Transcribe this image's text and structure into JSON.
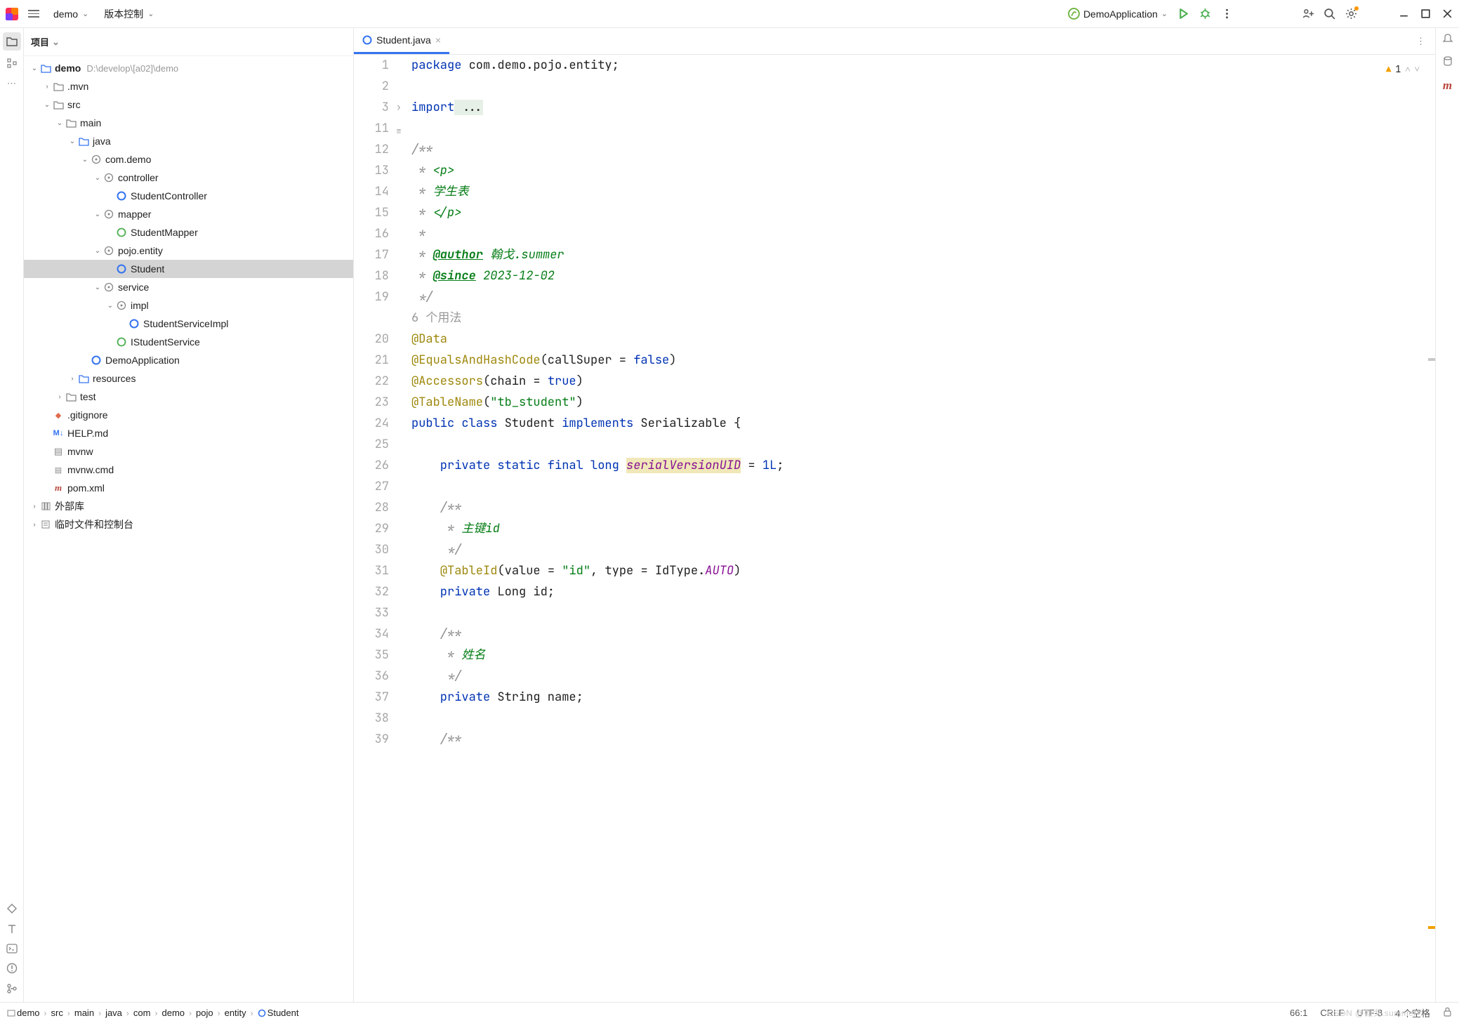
{
  "topbar": {
    "project": "demo",
    "vcs": "版本控制",
    "runConfig": "DemoApplication"
  },
  "sidebar": {
    "title": "项目"
  },
  "tree": [
    {
      "d": 0,
      "exp": "open",
      "ic": "folder-blue",
      "label": "demo",
      "path": "D:\\develop\\[a02]\\demo",
      "bold": true
    },
    {
      "d": 1,
      "exp": "closed",
      "ic": "folder",
      "label": ".mvn"
    },
    {
      "d": 1,
      "exp": "open",
      "ic": "folder",
      "label": "src"
    },
    {
      "d": 2,
      "exp": "open",
      "ic": "folder",
      "label": "main"
    },
    {
      "d": 3,
      "exp": "open",
      "ic": "folder-blue",
      "label": "java"
    },
    {
      "d": 4,
      "exp": "open",
      "ic": "pkg",
      "label": "com.demo"
    },
    {
      "d": 5,
      "exp": "open",
      "ic": "pkg",
      "label": "controller"
    },
    {
      "d": 6,
      "exp": "none",
      "ic": "class",
      "label": "StudentController"
    },
    {
      "d": 5,
      "exp": "open",
      "ic": "pkg",
      "label": "mapper"
    },
    {
      "d": 6,
      "exp": "none",
      "ic": "iface",
      "label": "StudentMapper"
    },
    {
      "d": 5,
      "exp": "open",
      "ic": "pkg",
      "label": "pojo.entity"
    },
    {
      "d": 6,
      "exp": "none",
      "ic": "class",
      "label": "Student",
      "sel": true
    },
    {
      "d": 5,
      "exp": "open",
      "ic": "pkg",
      "label": "service"
    },
    {
      "d": 6,
      "exp": "open",
      "ic": "pkg",
      "label": "impl"
    },
    {
      "d": 7,
      "exp": "none",
      "ic": "class",
      "label": "StudentServiceImpl"
    },
    {
      "d": 6,
      "exp": "none",
      "ic": "iface",
      "label": "IStudentService"
    },
    {
      "d": 4,
      "exp": "none",
      "ic": "class",
      "label": "DemoApplication"
    },
    {
      "d": 3,
      "exp": "closed",
      "ic": "folder-blue",
      "label": "resources"
    },
    {
      "d": 2,
      "exp": "closed",
      "ic": "folder",
      "label": "test"
    },
    {
      "d": 1,
      "exp": "none",
      "ic": "gitignore",
      "label": ".gitignore"
    },
    {
      "d": 1,
      "exp": "none",
      "ic": "md",
      "label": "HELP.md"
    },
    {
      "d": 1,
      "exp": "none",
      "ic": "any",
      "label": "mvnw"
    },
    {
      "d": 1,
      "exp": "none",
      "ic": "cmd",
      "label": "mvnw.cmd"
    },
    {
      "d": 1,
      "exp": "none",
      "ic": "maven",
      "label": "pom.xml"
    },
    {
      "d": 0,
      "exp": "closed",
      "ic": "lib",
      "label": "外部库"
    },
    {
      "d": 0,
      "exp": "closed",
      "ic": "scratch",
      "label": "临时文件和控制台"
    }
  ],
  "tab": {
    "name": "Student.java"
  },
  "inspections": {
    "warnings": "1"
  },
  "usages_hint": "6 个用法",
  "lineNumbers": [
    "1",
    "2",
    "3",
    "11",
    "12",
    "13",
    "14",
    "15",
    "16",
    "17",
    "18",
    "19",
    "",
    "20",
    "21",
    "22",
    "23",
    "24",
    "25",
    "26",
    "27",
    "28",
    "29",
    "30",
    "31",
    "32",
    "33",
    "34",
    "35",
    "36",
    "37",
    "38",
    "39"
  ],
  "code": {
    "l1_kw": "package",
    "l1_rest": " com.demo.pojo.entity;",
    "l3_kw": "import",
    "l3_fold": " ...",
    "l12": "/**",
    "l13a": " * ",
    "l13b": "<p>",
    "l14a": " * ",
    "l14b": "学生表",
    "l15a": " * ",
    "l15b": "</p>",
    "l16": " *",
    "l17a": " * ",
    "l17b": "@author",
    "l17c": " 翰戈.summer",
    "l18a": " * ",
    "l18b": "@since",
    "l18c": " 2023-12-02",
    "l19": " */",
    "l20": "@Data",
    "l21a": "@EqualsAndHashCode",
    "l21b": "(callSuper = ",
    "l21c": "false",
    "l21d": ")",
    "l22a": "@Accessors",
    "l22b": "(chain = ",
    "l22c": "true",
    "l22d": ")",
    "l23a": "@TableName",
    "l23b": "(",
    "l23c": "\"tb_student\"",
    "l23d": ")",
    "l24a": "public class ",
    "l24b": "Student ",
    "l24c": "implements ",
    "l24d": "Serializable {",
    "l26a": "    private static final long ",
    "l26b": "serialVersionUID",
    "l26c": " = ",
    "l26d": "1L",
    "l26e": ";",
    "l28": "    /**",
    "l29a": "     * ",
    "l29b": "主键id",
    "l30": "     */",
    "l31a": "    ",
    "l31b": "@TableId",
    "l31c": "(value = ",
    "l31d": "\"id\"",
    "l31e": ", type = IdType.",
    "l31f": "AUTO",
    "l31g": ")",
    "l32a": "    private ",
    "l32b": "Long id;",
    "l34": "    /**",
    "l35a": "     * ",
    "l35b": "姓名",
    "l36": "     */",
    "l37a": "    private ",
    "l37b": "String name;",
    "l39": "    /**"
  },
  "breadcrumbs": [
    "demo",
    "src",
    "main",
    "java",
    "com",
    "demo",
    "pojo",
    "entity",
    "Student"
  ],
  "statusbar": {
    "pos": "66:1",
    "linesep": "CRLF",
    "enc": "UTF-8",
    "indent": "4 个空格"
  },
  "watermark": "CSDN @翰戈.summer"
}
